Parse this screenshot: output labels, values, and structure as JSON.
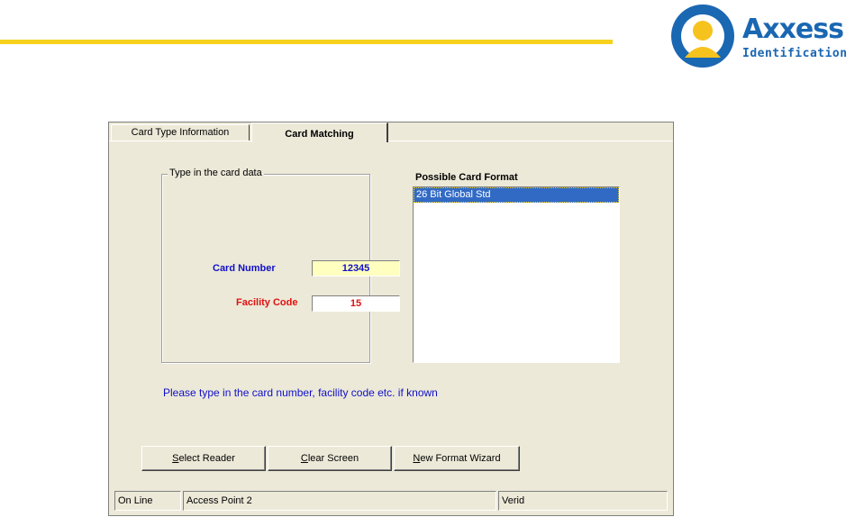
{
  "logo": {
    "name": "Axxess",
    "subtitle": "Identification",
    "icon": "person-icon"
  },
  "tabs": [
    {
      "label": "Card Type Information",
      "selected": false
    },
    {
      "label": "Card Matching",
      "selected": true
    }
  ],
  "group": {
    "title": "Type in the card data"
  },
  "card_number": {
    "label": "Card Number",
    "value": "12345",
    "color": "#1010c8"
  },
  "facility_code": {
    "label": "Facility Code",
    "value": "15",
    "color": "#e01010"
  },
  "format_list": {
    "title": "Possible Card Format",
    "items": [
      "26 Bit Global Std"
    ]
  },
  "hint": "Please type in the card number, facility code etc. if known",
  "buttons": {
    "select_reader": {
      "mnemonic": "S",
      "rest": "elect Reader"
    },
    "clear_screen": {
      "mnemonic": "C",
      "rest": "lear Screen"
    },
    "new_format_wizard": {
      "mnemonic": "N",
      "rest": "ew Format Wizard"
    }
  },
  "status": {
    "connection": "On Line",
    "access_point": "Access Point 2",
    "user": "Verid"
  },
  "colors": {
    "accent_yellow": "#f6d21e",
    "brand_blue": "#1a67b2",
    "selection": "#316ac5"
  }
}
